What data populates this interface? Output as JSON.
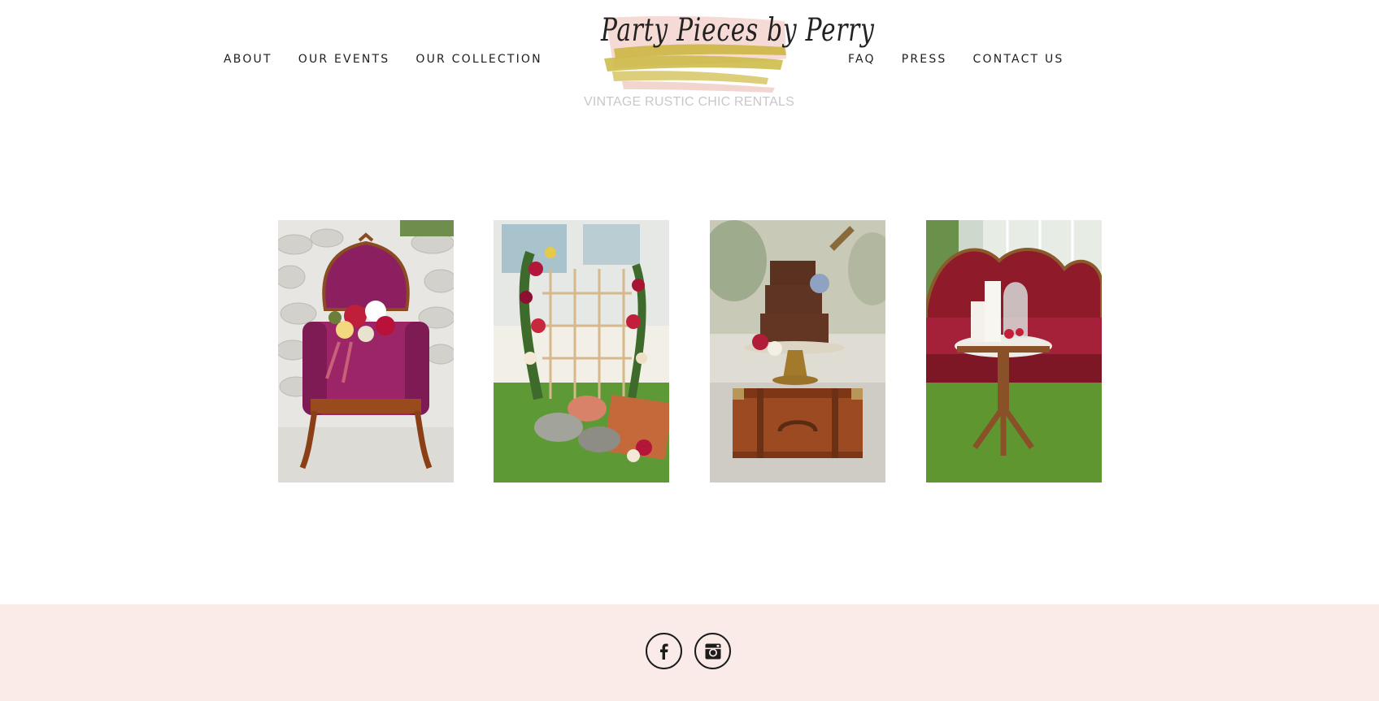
{
  "nav_left": [
    "ABOUT",
    "OUR EVENTS",
    "OUR COLLECTION"
  ],
  "nav_right": [
    "FAQ",
    "PRESS",
    "CONTACT US"
  ],
  "logo": {
    "title": "Party Pieces by Perry",
    "tagline": "VINTAGE RUSTIC CHIC RENTALS"
  },
  "gallery": [
    {
      "subject": "velvet-armchair-photo"
    },
    {
      "subject": "floral-backdrop-photo"
    },
    {
      "subject": "cake-on-suitcase-photo"
    },
    {
      "subject": "settee-and-side-table-photo"
    }
  ],
  "footer": {
    "social": [
      {
        "icon": "facebook-icon"
      },
      {
        "icon": "instagram-icon"
      }
    ]
  },
  "colors": {
    "footer_bg": "#faeae8",
    "text": "#1f1f1f",
    "tagline": "#c8c8c8",
    "brush_gold": "#c9b43a",
    "brush_pink": "#f5d6d0"
  }
}
